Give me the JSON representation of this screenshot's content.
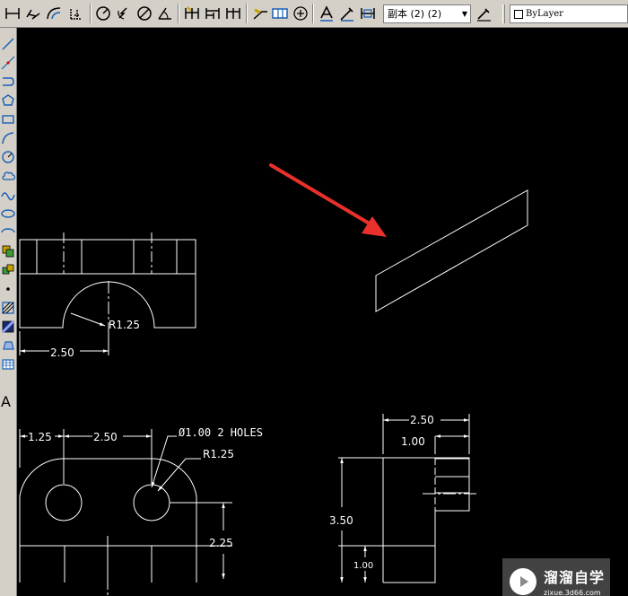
{
  "toolbar": {
    "text_style": "副本 (2) (2)",
    "layer_name": "ByLayer"
  },
  "left_toolbar": {
    "mtext_glyph": "A"
  },
  "drawing": {
    "front_view": {
      "radius_label": "R1.25",
      "width_label": "2.50"
    },
    "top_view": {
      "left_offset": "1.25",
      "hole_spacing": "2.50",
      "holes_note": "Ø1.00 2 HOLES",
      "radius_label": "R1.25",
      "height_label": "2.25"
    },
    "side_view": {
      "overall_width": "2.50",
      "slot_width": "1.00",
      "overall_height": "3.50",
      "base_height": "1.00"
    }
  },
  "watermark": {
    "title": "溜溜自学",
    "url": "zixue.3d66.com"
  },
  "colors": {
    "canvas_bg": "#000000",
    "line": "#ffffff",
    "arrow": "#e8312a",
    "toolbar_bg": "#d4d0c8"
  }
}
